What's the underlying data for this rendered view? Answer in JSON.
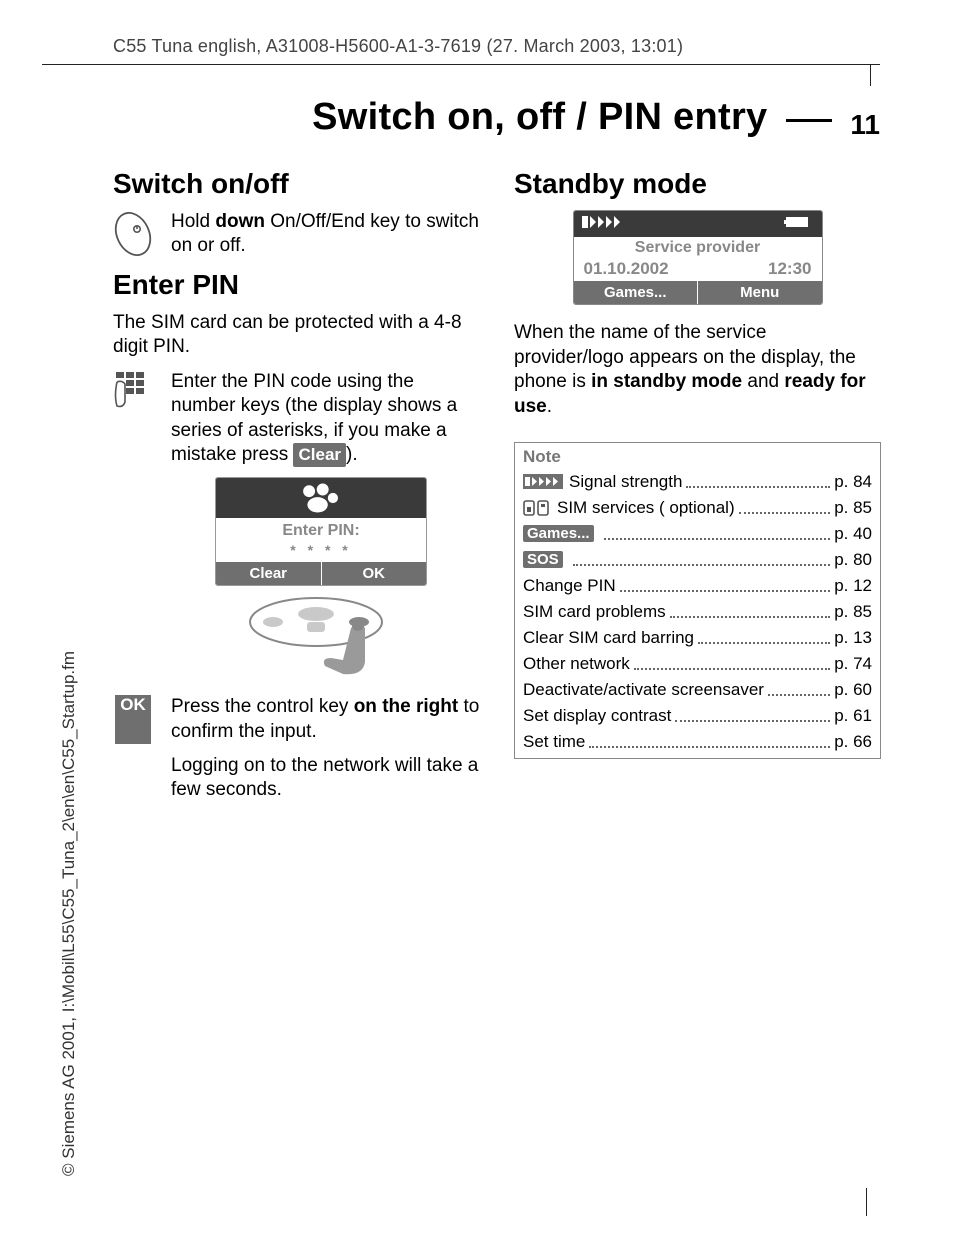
{
  "header": "C55 Tuna english, A31008-H5600-A1-3-7619 (27. March 2003, 13:01)",
  "chapter": {
    "title": "Switch on, off / PIN entry",
    "page": "11"
  },
  "copyright": "© Siemens AG 2001, I:\\Mobil\\L55\\C55_Tuna_2\\en\\en\\C55_Startup.fm",
  "left": {
    "h_switch": "Switch on/off",
    "switch_pre": "Hold ",
    "switch_bold": "down",
    "switch_post": " On/Off/End key to switch on or off.",
    "h_enter": "Enter PIN",
    "enter_p": "The SIM card can be protected with a 4-8 digit PIN.",
    "keyp_a": "Enter the PIN code using the number keys (the display shows a series of asterisks, if you make a mistake press ",
    "clear_lbl": "Clear",
    "keyp_b": ").",
    "pin_title": "Enter PIN:",
    "pin_stars": "* * * *",
    "soft_clear": "Clear",
    "soft_ok": "OK",
    "ok_tag": "OK",
    "ok_a": "Press the control key ",
    "ok_bold": "on the right",
    "ok_b": " to confirm the input.",
    "logon": "Logging on to the network will take a few seconds."
  },
  "right": {
    "h_standby": "Standby mode",
    "provider": "Service provider",
    "date": "01.10.2002",
    "time": "12:30",
    "soft_games": "Games...",
    "soft_menu": "Menu",
    "desc_a": "When the name of the service provider/logo appears on the display, the phone is ",
    "desc_b1": "in standby mode",
    "desc_mid": " and ",
    "desc_b2": "ready for use",
    "desc_c": ".",
    "note_h": "Note",
    "notes": [
      {
        "icon": "signal",
        "label": "Signal strength",
        "page": "p. 84"
      },
      {
        "icon": "sim",
        "label": "SIM services ( optional)",
        "page": "p. 85"
      },
      {
        "icon": "games",
        "label": "",
        "page": "p. 40"
      },
      {
        "icon": "sos",
        "label": "",
        "page": "p. 80"
      },
      {
        "label": "Change PIN",
        "page": "p. 12"
      },
      {
        "label": "SIM card problems",
        "page": "p. 85"
      },
      {
        "label": "Clear SIM card barring",
        "page": "p. 13"
      },
      {
        "label": "Other network",
        "page": "p. 74"
      },
      {
        "label": "Deactivate/activate screensaver",
        "page": "p. 60"
      },
      {
        "label": "Set display contrast",
        "page": "p. 61"
      },
      {
        "label": "Set time",
        "page": "p. 66"
      }
    ],
    "games_tag": "Games...",
    "sos_tag": "SOS"
  }
}
